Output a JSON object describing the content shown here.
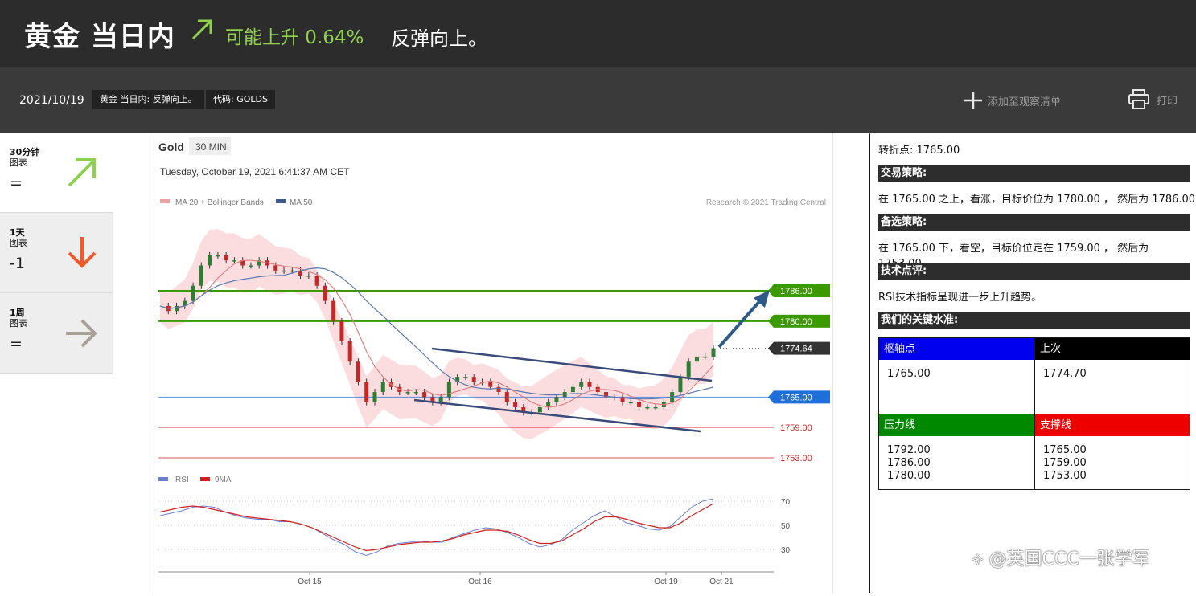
{
  "header": {
    "title": "黄金 当日内",
    "trend_text": "可能上升 0.64%",
    "subtitle": "反弹向上。"
  },
  "subbar": {
    "date": "2021/10/19",
    "tag1": "黄金 当日内: 反弹向上。",
    "tag2": "代码: GOLDS",
    "watchlist_label": "添加至观察清单",
    "print_label": "打印"
  },
  "timeframes": [
    {
      "label_line1": "30分钟",
      "label_line2": "图表",
      "value": "=",
      "arrow": "up-right",
      "color": "#8fd14f"
    },
    {
      "label_line1": "1天",
      "label_line2": "图表",
      "value": "-1",
      "arrow": "down",
      "color": "#ef5a2a"
    },
    {
      "label_line1": "1周",
      "label_line2": "图表",
      "value": "=",
      "arrow": "right",
      "color": "#a89f95"
    }
  ],
  "chart": {
    "instrument": "Gold",
    "interval": "30 MIN",
    "timestamp": "Tuesday, October 19, 2021 6:41:37 AM CET",
    "legend1": "MA 20 + Bollinger Bands",
    "legend2": "MA 50",
    "credit": "Research © 2021 Trading Central",
    "rsi_legend1": "RSI",
    "rsi_legend2": "9MA"
  },
  "chart_data": {
    "type": "line",
    "x_labels": [
      "Oct 15",
      "Oct 16",
      "Oct 19",
      "Oct 21"
    ],
    "price_levels": [
      {
        "label": "1786.00",
        "value": 1786.0,
        "color": "#3a9a00"
      },
      {
        "label": "1780.00",
        "value": 1780.0,
        "color": "#3a9a00"
      },
      {
        "label": "1774.64",
        "value": 1774.64,
        "color": "#333333"
      },
      {
        "label": "1765.00",
        "value": 1765.0,
        "color": "#1e6fd9"
      },
      {
        "label": "1759.00",
        "value": 1759.0,
        "color": "#cc2222"
      },
      {
        "label": "1753.00",
        "value": 1753.0,
        "color": "#cc2222"
      }
    ],
    "price_series": [
      1783,
      1782,
      1783,
      1784,
      1787,
      1791,
      1793,
      1793,
      1792,
      1792,
      1791,
      1791,
      1792,
      1791,
      1790,
      1790,
      1790,
      1789,
      1789,
      1787,
      1784,
      1780,
      1776,
      1772,
      1768,
      1764,
      1766,
      1768,
      1767,
      1766,
      1766,
      1766,
      1765,
      1764,
      1765,
      1768,
      1769,
      1769,
      1768,
      1768,
      1767,
      1766,
      1764,
      1763,
      1762,
      1762,
      1763,
      1764,
      1765,
      1766,
      1767,
      1768,
      1767,
      1766,
      1765,
      1765,
      1764,
      1764,
      1763,
      1763,
      1763,
      1764,
      1766,
      1769,
      1772,
      1773,
      1773,
      1774.64
    ],
    "rsi_ticks": [
      70,
      50,
      30
    ],
    "rsi_series": [
      58,
      60,
      62,
      65,
      66,
      65,
      61,
      58,
      56,
      55,
      55,
      53,
      53,
      51,
      48,
      43,
      38,
      34,
      28,
      25,
      28,
      33,
      35,
      36,
      37,
      36,
      36,
      40,
      43,
      46,
      48,
      47,
      44,
      40,
      35,
      32,
      34,
      38,
      46,
      52,
      58,
      62,
      57,
      52,
      50,
      47,
      46,
      49,
      57,
      65,
      70,
      72
    ],
    "rsi_ma_series": [
      61,
      63,
      65,
      66,
      65,
      63,
      61,
      59,
      57,
      56,
      55,
      54,
      53,
      51,
      48,
      44,
      40,
      36,
      32,
      29,
      30,
      32,
      34,
      35,
      36,
      36,
      37,
      39,
      42,
      44,
      46,
      46,
      45,
      42,
      38,
      35,
      35,
      37,
      42,
      47,
      53,
      57,
      57,
      55,
      52,
      50,
      48,
      48,
      52,
      58,
      63,
      68
    ]
  },
  "analysis": {
    "pivot_line": "转折点: 1765.00",
    "strategy_title": "交易策略:",
    "strategy_text": "在 1765.00 之上，看涨，目标价位为 1780.00 ， 然后为 1786.00 。",
    "alt_title": "备选策略:",
    "alt_text": "在 1765.00 下，看空，目标价位定在 1759.00 ， 然后为 1753.00。",
    "tech_title": "技术点评:",
    "tech_text": "RSI技术指标呈现进一步上升趋势。",
    "key_title": "我们的关键水准:"
  },
  "key_levels": {
    "pivot_label": "枢轴点",
    "pivot_value": "1765.00",
    "last_label": "上次",
    "last_value": "1774.70",
    "resistance_label": "压力线",
    "resistance_values": [
      "1792.00",
      "1786.00",
      "1780.00"
    ],
    "support_label": "支撑线",
    "support_values": [
      "1765.00",
      "1759.00",
      "1753.00"
    ],
    "colors": {
      "pivot": "#0000ee",
      "last": "#000000",
      "resistance": "#008800",
      "support": "#ee0000"
    }
  },
  "watermark": "⟡ @英国CCC一张学军"
}
